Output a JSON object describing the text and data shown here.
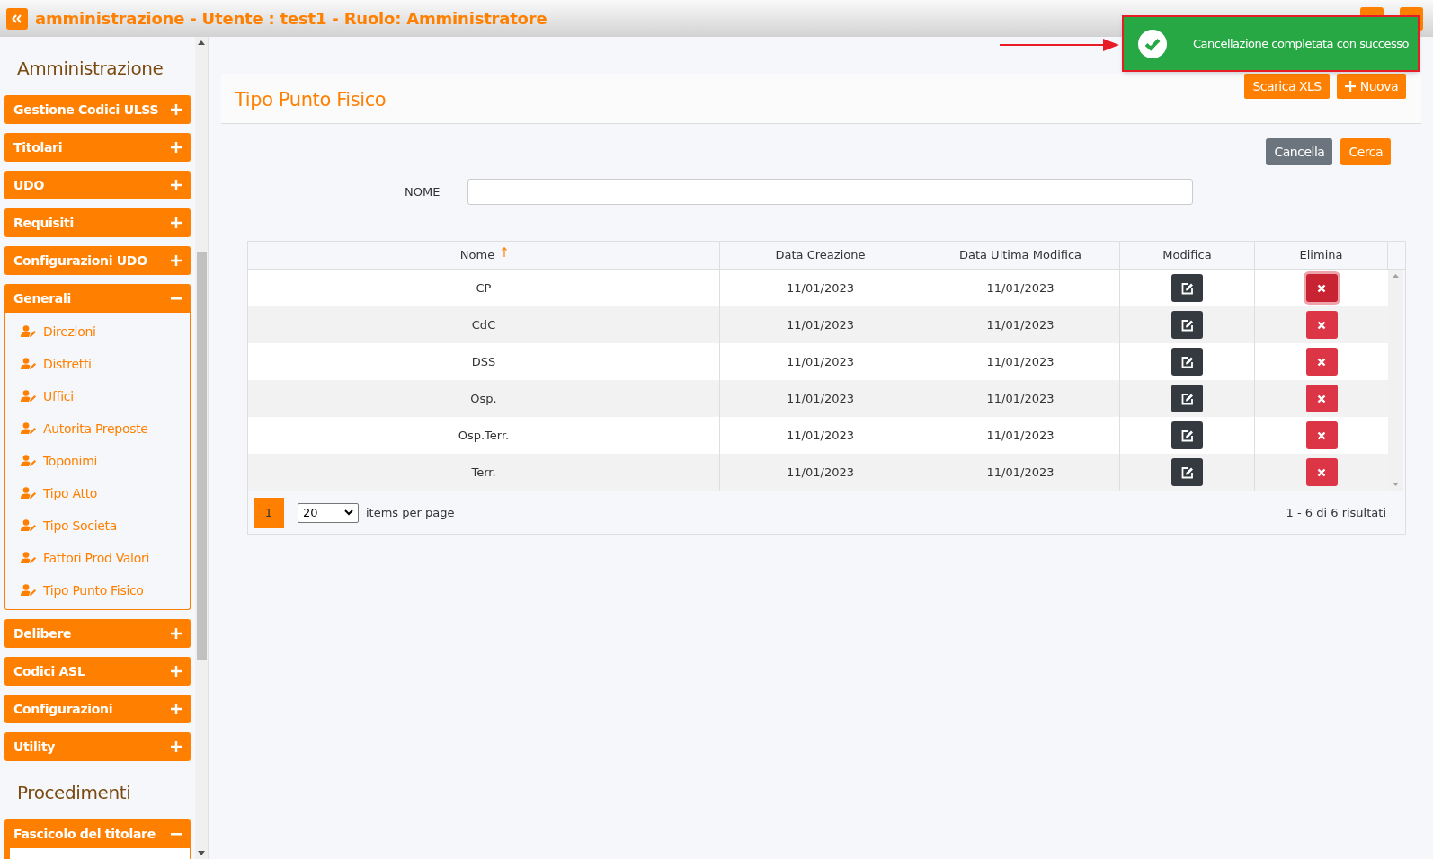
{
  "header": {
    "title": "amministrazione - Utente : test1 - Ruolo: Amministratore"
  },
  "sidebar": {
    "sections": [
      {
        "title": "Amministrazione",
        "groups": [
          {
            "label": "Gestione Codici ULSS",
            "expanded": false
          },
          {
            "label": "Titolari",
            "expanded": false
          },
          {
            "label": "UDO",
            "expanded": false
          },
          {
            "label": "Requisiti",
            "expanded": false
          },
          {
            "label": "Configurazioni UDO",
            "expanded": false
          },
          {
            "label": "Generali",
            "expanded": true,
            "children": [
              "Direzioni",
              "Distretti",
              "Uffici",
              "Autorita Preposte",
              "Toponimi",
              "Tipo Atto",
              "Tipo Societa",
              "Fattori Prod Valori",
              "Tipo Punto Fisico"
            ]
          },
          {
            "label": "Delibere",
            "expanded": false
          },
          {
            "label": "Codici ASL",
            "expanded": false
          },
          {
            "label": "Configurazioni",
            "expanded": false
          },
          {
            "label": "Utility",
            "expanded": false
          }
        ]
      },
      {
        "title": "Procedimenti",
        "groups": [
          {
            "label": "Fascicolo del titolare",
            "expanded": true
          }
        ]
      }
    ]
  },
  "toast": {
    "message": "Cancellazione completata con successo"
  },
  "page": {
    "title": "Tipo Punto Fisico",
    "actions": [
      {
        "label": "Scarica XLS",
        "kind": "plain"
      },
      {
        "label": "Nuova",
        "kind": "add"
      }
    ]
  },
  "filter": {
    "buttons": [
      {
        "label": "Cancella",
        "kind": "secondary"
      },
      {
        "label": "Cerca",
        "kind": "primary"
      }
    ],
    "field_label": "NOME"
  },
  "table": {
    "columns": [
      {
        "label": "Nome",
        "sorted": true
      },
      {
        "label": "Data Creazione",
        "sorted": false
      },
      {
        "label": "Data Ultima Modifica",
        "sorted": false
      },
      {
        "label": "Modifica",
        "sorted": false
      },
      {
        "label": "Elimina",
        "sorted": false
      }
    ],
    "rows": [
      {
        "nome": "CP",
        "created": "11/01/2023",
        "modified": "11/01/2023",
        "delete_focused": true
      },
      {
        "nome": "CdC",
        "created": "11/01/2023",
        "modified": "11/01/2023",
        "delete_focused": false
      },
      {
        "nome": "DSS",
        "created": "11/01/2023",
        "modified": "11/01/2023",
        "delete_focused": false
      },
      {
        "nome": "Osp.",
        "created": "11/01/2023",
        "modified": "11/01/2023",
        "delete_focused": false
      },
      {
        "nome": "Osp.Terr.",
        "created": "11/01/2023",
        "modified": "11/01/2023",
        "delete_focused": false
      },
      {
        "nome": "Terr.",
        "created": "11/01/2023",
        "modified": "11/01/2023",
        "delete_focused": false
      }
    ]
  },
  "pagination": {
    "pages": [
      {
        "label": "1",
        "selected": true
      }
    ],
    "page_size": "20",
    "page_size_label": "items per page",
    "summary": "1 - 6 di 6 risultati"
  }
}
